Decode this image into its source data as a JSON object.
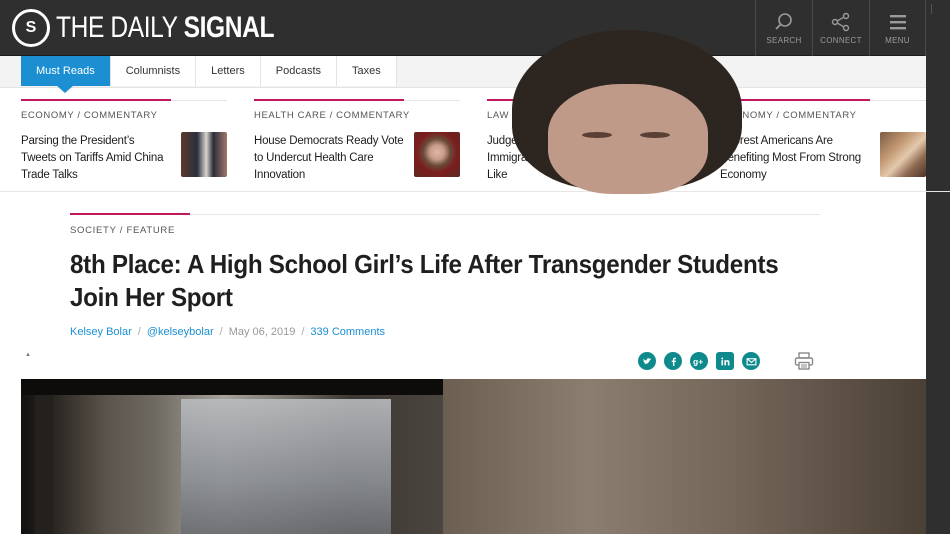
{
  "header": {
    "logo_mark": "S",
    "logo_light": "THE DAILY ",
    "logo_bold": "SIGNAL",
    "tools": [
      {
        "label": "SEARCH",
        "icon": "search-icon"
      },
      {
        "label": "CONNECT",
        "icon": "share-icon"
      },
      {
        "label": "MENU",
        "icon": "hamburger-icon"
      }
    ]
  },
  "nav": {
    "tabs": [
      "Must Reads",
      "Columnists",
      "Letters",
      "Podcasts",
      "Taxes"
    ],
    "active": "Must Reads"
  },
  "trending": [
    {
      "category": "ECONOMY / COMMENTARY",
      "title": "Parsing the President’s Tweets on Tariffs Amid China Trade Talks"
    },
    {
      "category": "HEALTH CARE / COMMENTARY",
      "title": "House Democrats Ready Vote to Undercut Health Care Innovation"
    },
    {
      "category": "LAW / COMMENTARY",
      "title": "Judges Can’t Ignore Immigration Laws They Don’t Like"
    },
    {
      "category": "ECONOMY / COMMENTARY",
      "title": "Poorest Americans Are Benefiting Most From Strong Economy"
    }
  ],
  "article": {
    "category": "SOCIETY / FEATURE",
    "headline": "8th Place: A High School Girl’s Life After Transgender Students Join Her Sport",
    "author": "Kelsey Bolar",
    "handle": "@kelseybolar",
    "date": "May 06, 2019",
    "comments": "339 Comments"
  },
  "share_icons": [
    "twitter-icon",
    "facebook-icon",
    "google-plus-icon",
    "linkedin-icon",
    "email-icon",
    "print-icon"
  ],
  "colors": {
    "header_bg": "#2f2f2f",
    "accent_blue": "#1b8fd1",
    "accent_red": "#c2185b",
    "share_teal": "#0f8a8c"
  }
}
